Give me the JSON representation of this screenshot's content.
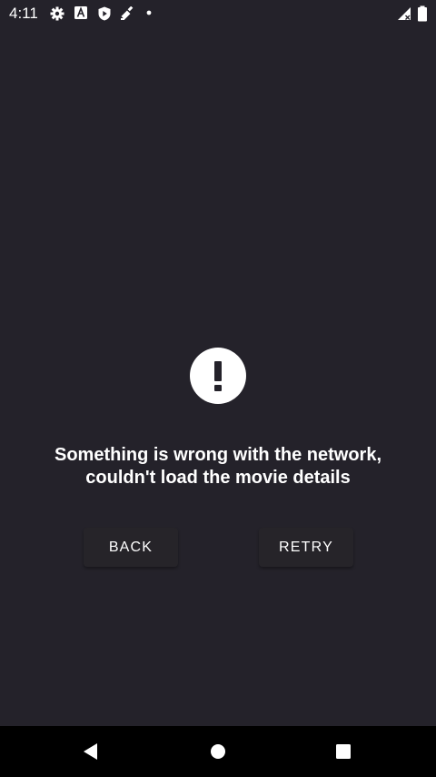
{
  "status_bar": {
    "time": "4:11",
    "icons": [
      "settings-gear-icon",
      "accessibility-a-icon",
      "shield-play-icon",
      "satellite-dish-icon",
      "notification-dot-icon",
      "cell-signal-icon",
      "battery-icon"
    ]
  },
  "error": {
    "icon": "exclamation-icon",
    "message": "Something is wrong with the network, couldn't load the movie details"
  },
  "buttons": {
    "back_label": "BACK",
    "retry_label": "RETRY"
  },
  "nav_bar": {
    "icons": [
      "nav-back-icon",
      "nav-home-icon",
      "nav-recents-icon"
    ]
  },
  "colors": {
    "background": "#24222a",
    "button_bg": "#262429",
    "text": "#ffffff",
    "nav_bar": "#000000"
  }
}
